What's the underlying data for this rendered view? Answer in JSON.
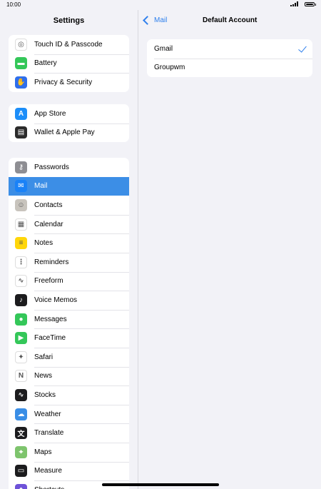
{
  "status": {
    "time": "10:00"
  },
  "sidebar": {
    "title": "Settings",
    "groups": [
      {
        "items": [
          {
            "label": "Touch ID & Passcode",
            "icon": "fingerprint-icon",
            "color": "#ffffff"
          },
          {
            "label": "Battery",
            "icon": "battery-icon",
            "color": "#34c759"
          },
          {
            "label": "Privacy & Security",
            "icon": "hand-icon",
            "color": "#2f6fec"
          }
        ]
      },
      {
        "items": [
          {
            "label": "App Store",
            "icon": "app-store-icon",
            "color": "#1c8ef9"
          },
          {
            "label": "Wallet & Apple Pay",
            "icon": "wallet-icon",
            "color": "#2b2b2b"
          }
        ]
      },
      {
        "items": [
          {
            "label": "Passwords",
            "icon": "key-icon",
            "color": "#8e8e93"
          },
          {
            "label": "Mail",
            "icon": "mail-icon",
            "color": "#1a82f7"
          },
          {
            "label": "Contacts",
            "icon": "contacts-icon",
            "color": "#c8c4bd"
          },
          {
            "label": "Calendar",
            "icon": "calendar-icon",
            "color": "#ffffff"
          },
          {
            "label": "Notes",
            "icon": "notes-icon",
            "color": "#ffd60a"
          },
          {
            "label": "Reminders",
            "icon": "reminders-icon",
            "color": "#ffffff"
          },
          {
            "label": "Freeform",
            "icon": "freeform-icon",
            "color": "#ffffff"
          },
          {
            "label": "Voice Memos",
            "icon": "voice-memos-icon",
            "color": "#1c1c1e"
          },
          {
            "label": "Messages",
            "icon": "messages-icon",
            "color": "#34c759"
          },
          {
            "label": "FaceTime",
            "icon": "facetime-icon",
            "color": "#34c759"
          },
          {
            "label": "Safari",
            "icon": "safari-icon",
            "color": "#ffffff"
          },
          {
            "label": "News",
            "icon": "news-icon",
            "color": "#ffffff"
          },
          {
            "label": "Stocks",
            "icon": "stocks-icon",
            "color": "#1c1c1e"
          },
          {
            "label": "Weather",
            "icon": "weather-icon",
            "color": "#3a8ee6"
          },
          {
            "label": "Translate",
            "icon": "translate-icon",
            "color": "#1c1c1e"
          },
          {
            "label": "Maps",
            "icon": "maps-icon",
            "color": "#7ec46d"
          },
          {
            "label": "Measure",
            "icon": "measure-icon",
            "color": "#1c1c1e"
          },
          {
            "label": "Shortcuts",
            "icon": "shortcuts-icon",
            "color": "#6e52d8"
          }
        ]
      }
    ],
    "selected": "Mail"
  },
  "detail": {
    "back_label": "Mail",
    "title": "Default Account",
    "options": [
      {
        "label": "Gmail",
        "checked": true
      },
      {
        "label": "Groupwm",
        "checked": false
      }
    ]
  },
  "colors": {
    "accent": "#2f80ed",
    "selected_row": "#3c8ee6"
  }
}
